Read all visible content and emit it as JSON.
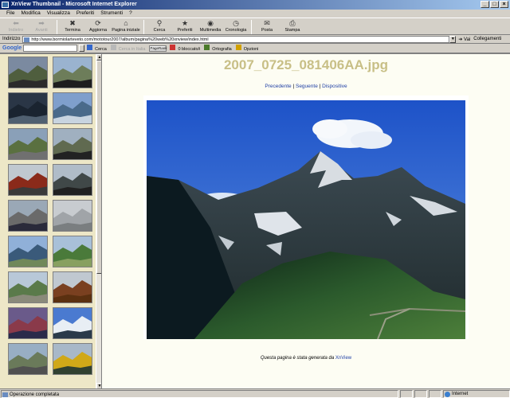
{
  "window": {
    "title": "XnView Thumbnail - Microsoft Internet Explorer",
    "btn_min": "_",
    "btn_max": "□",
    "btn_close": "×"
  },
  "menu": [
    "File",
    "Modifica",
    "Visualizza",
    "Preferiti",
    "Strumenti",
    "?"
  ],
  "toolbar": [
    {
      "label": "Indietro",
      "icon": "back-arrow-icon",
      "glyph": "⬅",
      "disabled": true
    },
    {
      "label": "Avanti",
      "icon": "forward-arrow-icon",
      "glyph": "➡",
      "disabled": true
    },
    {
      "label": "Termina",
      "icon": "stop-icon",
      "glyph": "✖",
      "disabled": false
    },
    {
      "label": "Aggiorna",
      "icon": "refresh-icon",
      "glyph": "⟳",
      "disabled": false
    },
    {
      "label": "Pagina iniziale",
      "icon": "home-icon",
      "glyph": "⌂",
      "disabled": false
    },
    {
      "label": "Cerca",
      "icon": "search-icon",
      "glyph": "⚲",
      "disabled": false
    },
    {
      "label": "Preferiti",
      "icon": "favorites-icon",
      "glyph": "★",
      "disabled": false
    },
    {
      "label": "Multimedia",
      "icon": "media-icon",
      "glyph": "◉",
      "disabled": false
    },
    {
      "label": "Cronologia",
      "icon": "history-icon",
      "glyph": "◷",
      "disabled": false
    },
    {
      "label": "Posta",
      "icon": "mail-icon",
      "glyph": "✉",
      "disabled": false
    },
    {
      "label": "Stampa",
      "icon": "print-icon",
      "glyph": "⎙",
      "disabled": false
    }
  ],
  "address": {
    "label": "Indirizzo",
    "url": "http://www.bormiolarteveto.com/mototour2007/album/pagina%20web%20xnview/index.html",
    "go": "Vai",
    "links": "Collegamenti"
  },
  "google_bar": {
    "logo": "Google",
    "items": [
      {
        "label": "Cerca",
        "icon": "search-icon",
        "disabled": false
      },
      {
        "label": "Cerca in Italia",
        "icon": "italy-search-icon",
        "disabled": true
      },
      {
        "label": "PageRank",
        "icon": "pagerank-icon",
        "disabled": false,
        "pr": true
      },
      {
        "label": "0 bloccato/i",
        "icon": "popup-blocker-icon",
        "disabled": false
      },
      {
        "label": "Ortografia",
        "icon": "spellcheck-icon",
        "disabled": false
      },
      {
        "label": "Opzioni",
        "icon": "options-icon",
        "disabled": false
      }
    ]
  },
  "page": {
    "title": "2007_0725_081406AA.jpg",
    "nav_prev": "Precedente",
    "nav_sep": "|",
    "nav_next": "Seguente",
    "nav_slideshow": "Dispositive",
    "footer_text": "Questa pagina è stata generata da",
    "footer_link": "XnView"
  },
  "thumbnails": [
    [
      "road-bikes",
      "touring-bike"
    ],
    [
      "dark-lake",
      "mountain-lake"
    ],
    [
      "mountain-road",
      "parked-bike"
    ],
    [
      "red-building",
      "riders-group"
    ],
    [
      "village-bikes",
      "rainy-road"
    ],
    [
      "lake-view",
      "green-hills"
    ],
    [
      "roadside",
      "wooden-chalet"
    ],
    [
      "riders-portrait",
      "snowy-peak"
    ],
    [
      "curvy-road",
      "yellow-bike"
    ]
  ],
  "status": {
    "text": "Operazione completata",
    "zone": "Internet"
  }
}
